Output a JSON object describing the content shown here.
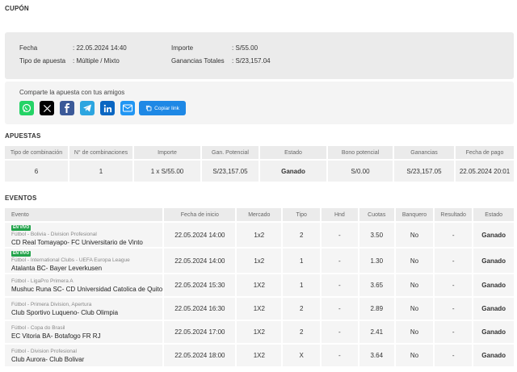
{
  "sections": {
    "cupon": "CUPÓN",
    "apuestas": "APUESTAS",
    "eventos": "EVENTOS"
  },
  "summary": {
    "fecha_label": "Fecha",
    "fecha_value": ": 22.05.2024 14:40",
    "tipo_label": "Tipo de apuesta",
    "tipo_value": ": Múltiple / Mixto",
    "importe_label": "Importe",
    "importe_value": ": S/55.00",
    "ganancias_label": "Ganancias Totales",
    "ganancias_value": ": S/23,157.04"
  },
  "share": {
    "text": "Comparte la apuesta con tus amigos",
    "copy_label": "Copiar link",
    "colors": {
      "whatsapp": "#25d366",
      "x": "#000000",
      "facebook": "#3b5998",
      "telegram": "#2ca5e0",
      "linkedin": "#0a66c2",
      "email": "#2196f3",
      "copy": "#1e88e5"
    }
  },
  "apuestas": {
    "headers": [
      "Tipo de combinación",
      "N° de combinaciones",
      "Importe",
      "Gan. Potencial",
      "Estado",
      "Bono potencial",
      "Ganancias",
      "Fecha de pago"
    ],
    "row": [
      "6",
      "1",
      "1 x S/55.00",
      "S/23,157.05",
      "Ganado",
      "S/0.00",
      "S/23,157.05",
      "22.05.2024 20:01"
    ]
  },
  "eventos": {
    "headers": [
      "Evento",
      "Fecha de inicio",
      "Mercado",
      "Tipo",
      "Hnd",
      "Cuotas",
      "Banquero",
      "Resultado",
      "Estado"
    ],
    "live_label": "EN VIVO",
    "rows": [
      {
        "live": true,
        "league": "Fútbol - Bolivia - Division Profesional",
        "match": "CD Real Tomayapo- FC Universitario de Vinto",
        "fecha": "22.05.2024 14:00",
        "mercado": "1x2",
        "tipo": "2",
        "hnd": "-",
        "cuota": "3.50",
        "banquero": "No",
        "resultado": "-",
        "estado": "Ganado"
      },
      {
        "live": true,
        "league": "Fútbol - International Clubs - UEFA Europa League",
        "match": "Atalanta BC- Bayer Leverkusen",
        "fecha": "22.05.2024 14:00",
        "mercado": "1x2",
        "tipo": "1",
        "hnd": "-",
        "cuota": "1.30",
        "banquero": "No",
        "resultado": "-",
        "estado": "Ganado"
      },
      {
        "live": false,
        "league": "Fútbol - LigaPro Primera A",
        "match": "Mushuc Runa SC- CD Universidad Catolica de Quito",
        "fecha": "22.05.2024 15:30",
        "mercado": "1X2",
        "tipo": "1",
        "hnd": "-",
        "cuota": "3.65",
        "banquero": "No",
        "resultado": "-",
        "estado": "Ganado"
      },
      {
        "live": false,
        "league": "Fútbol - Primera Division, Apertura",
        "match": "Club Sportivo Luqueno- Club Olimpia",
        "fecha": "22.05.2024 16:30",
        "mercado": "1X2",
        "tipo": "2",
        "hnd": "-",
        "cuota": "2.89",
        "banquero": "No",
        "resultado": "-",
        "estado": "Ganado"
      },
      {
        "live": false,
        "league": "Fútbol - Copa do Brasil",
        "match": "EC Vitoria BA- Botafogo FR RJ",
        "fecha": "22.05.2024 17:00",
        "mercado": "1X2",
        "tipo": "2",
        "hnd": "-",
        "cuota": "2.41",
        "banquero": "No",
        "resultado": "-",
        "estado": "Ganado"
      },
      {
        "live": false,
        "league": "Fútbol - Division Profesional",
        "match": "Club Aurora- Club Bolivar",
        "fecha": "22.05.2024 18:00",
        "mercado": "1X2",
        "tipo": "X",
        "hnd": "-",
        "cuota": "3.64",
        "banquero": "No",
        "resultado": "-",
        "estado": "Ganado"
      }
    ]
  }
}
